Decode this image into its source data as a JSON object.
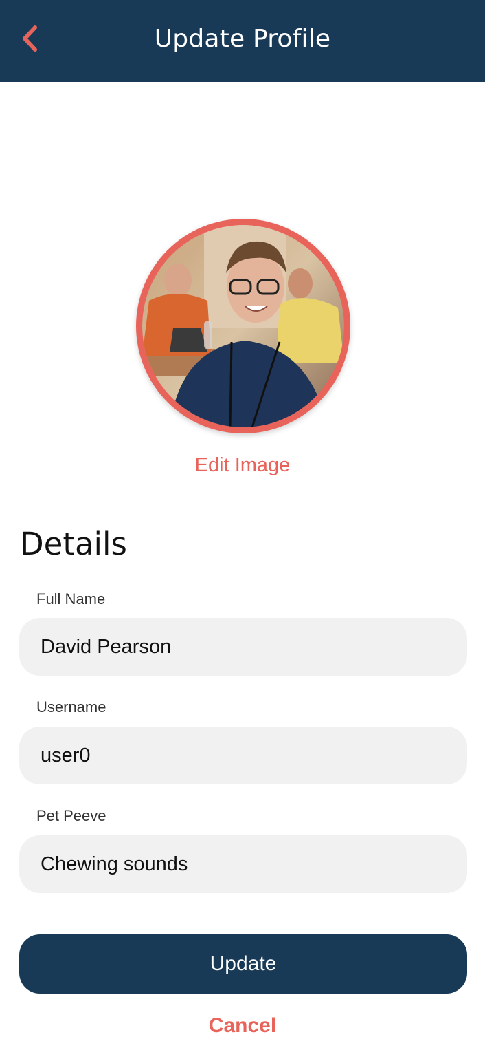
{
  "header": {
    "title": "Update Profile",
    "back_icon": "chevron-left-icon"
  },
  "profile": {
    "edit_image_label": "Edit Image"
  },
  "details": {
    "title": "Details",
    "fields": [
      {
        "label": "Full Name",
        "value": "David Pearson"
      },
      {
        "label": "Username",
        "value": "user0"
      },
      {
        "label": "Pet Peeve",
        "value": "Chewing sounds"
      }
    ]
  },
  "actions": {
    "update_label": "Update",
    "cancel_label": "Cancel"
  },
  "colors": {
    "header_bg": "#193a57",
    "accent": "#e8645a",
    "field_bg": "#f1f1f1",
    "primary_button": "#193a57"
  }
}
